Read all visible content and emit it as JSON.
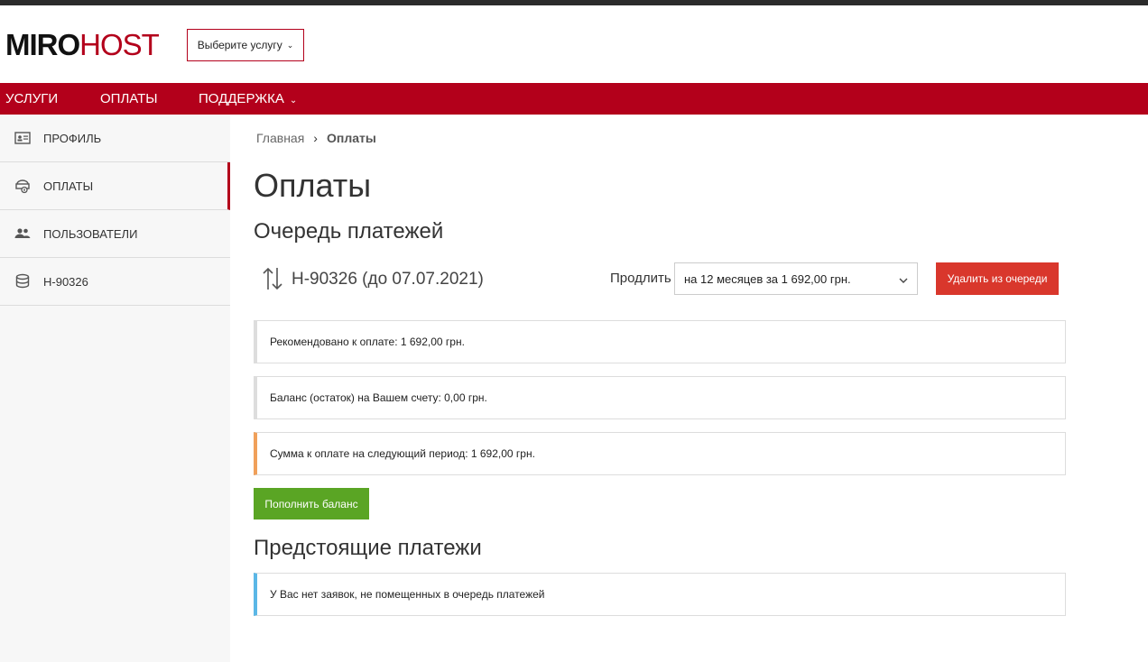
{
  "header": {
    "logo_part1": "MIRO",
    "logo_part2": "HOST",
    "service_select_label": "Выберите услугу"
  },
  "nav": {
    "items": [
      {
        "label": "УСЛУГИ"
      },
      {
        "label": "ОПЛАТЫ"
      },
      {
        "label": "ПОДДЕРЖКА"
      }
    ]
  },
  "sidebar": {
    "items": [
      {
        "label": "ПРОФИЛЬ",
        "icon": "profile-card-icon"
      },
      {
        "label": "ОПЛАТЫ",
        "icon": "payments-icon",
        "active": true
      },
      {
        "label": "ПОЛЬЗОВАТЕЛИ",
        "icon": "users-icon"
      },
      {
        "label": "H-90326",
        "icon": "database-icon"
      }
    ]
  },
  "breadcrumb": {
    "home": "Главная",
    "current": "Оплаты"
  },
  "main": {
    "page_title": "Оплаты",
    "queue_title": "Очередь платежей",
    "queue_item": {
      "service": "H-90326 (до 07.07.2021)",
      "extend_label": "Продлить",
      "period_selected": "на 12 месяцев за 1 692,00 грн.",
      "delete_label": "Удалить из очереди"
    },
    "recommended": "Рекомендовано к оплате: 1 692,00 грн.",
    "balance": "Баланс (остаток) на Вашем счету: 0,00 грн.",
    "next_sum": "Сумма к оплате на следующий период: 1 692,00 грн.",
    "topup_label": "Пополнить баланс",
    "upcoming_title": "Предстоящие платежи",
    "upcoming_empty": "У Вас нет заявок, не помещенных в очередь платежей"
  },
  "colors": {
    "brand": "#b3001b",
    "danger_button": "#d9372c",
    "success_button": "#5aa524",
    "warn_border": "#f0a05a",
    "info_border": "#5bb7e6"
  }
}
